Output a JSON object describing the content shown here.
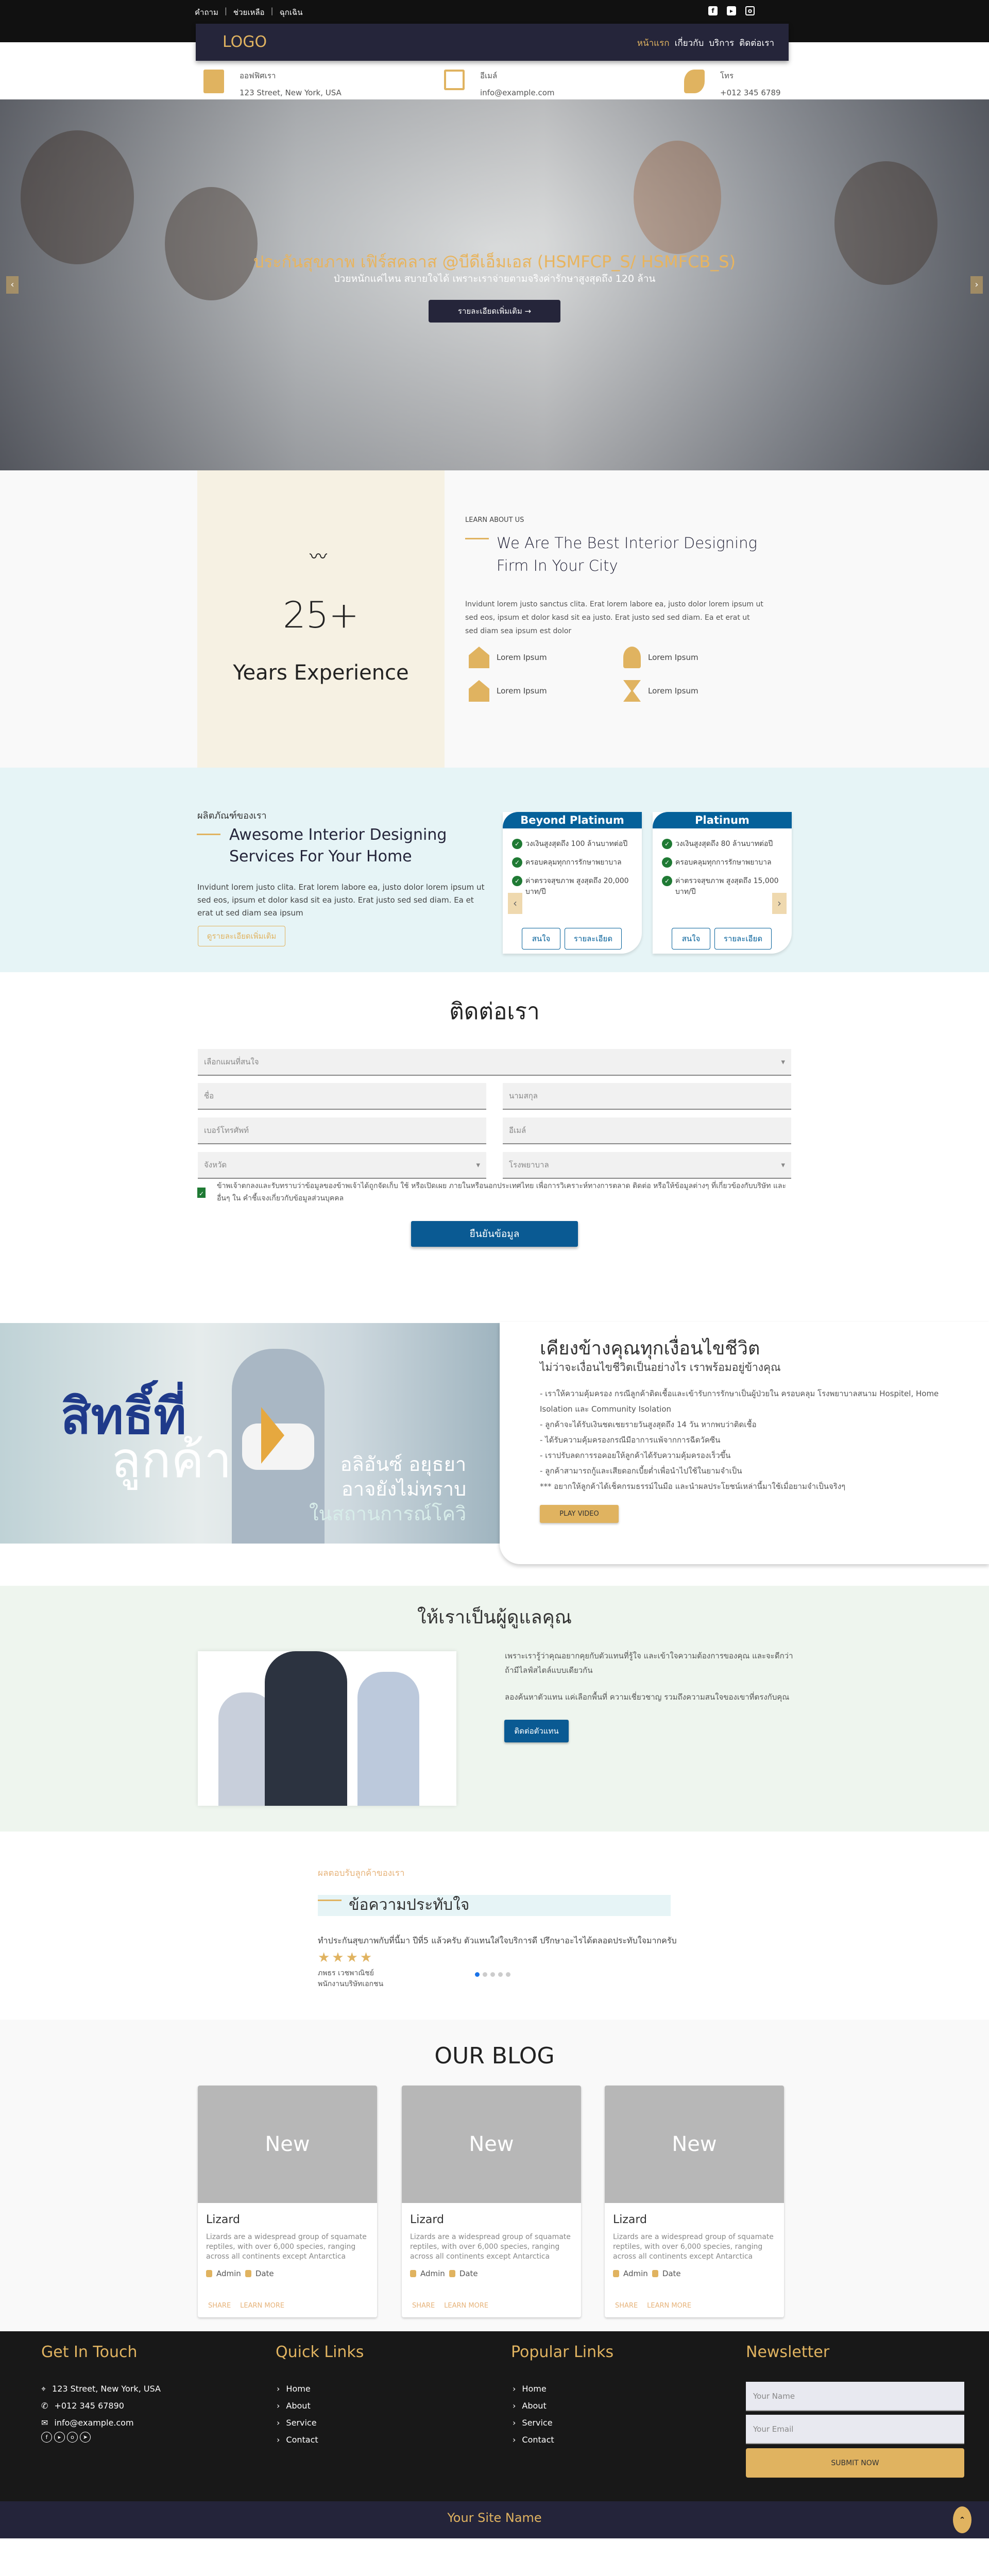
{
  "topbar": {
    "links": [
      "คำถาม",
      "ช่วยเหลือ",
      "ฉุกเฉิน"
    ],
    "social": [
      "facebook-icon",
      "youtube-icon",
      "instagram-icon"
    ]
  },
  "nav": {
    "logo": "LOGO",
    "menu": [
      "หน้าแรก",
      "เกี่ยวกับ",
      "บริการ",
      "ติดต่อเรา"
    ],
    "active": 0
  },
  "info": [
    {
      "icon": "building-icon",
      "label": "ออฟฟิศเรา",
      "value": "123 Street, New York, USA"
    },
    {
      "icon": "envelope-icon",
      "label": "อีเมล์",
      "value": "info@example.com"
    },
    {
      "icon": "phone-icon",
      "label": "โทร",
      "value": "+012 345 6789"
    }
  ],
  "hero": {
    "title": "ประกันสุขภาพ เฟิร์สคลาส @บีดีเอ็มเอส (HSMFCP_S/ HSMFCB_S)",
    "subtitle": "ป่วยหนักแค่ไหน สบายใจได้ เพราะเราจ่ายตามจริงค่ารักษาสูงสุดถึง 120 ล้าน",
    "button": "รายละเอียดเพิ่มเติม →",
    "prev": "‹",
    "next": "›"
  },
  "about": {
    "exp_number": "25+",
    "exp_label": "Years Experience",
    "kicker": "LEARN ABOUT US",
    "title": "We Are The Best Interior Designing Firm In Your City",
    "text": "Invidunt lorem justo sanctus clita. Erat lorem labore ea, justo dolor lorem ipsum ut sed eos, ipsum et dolor kasd sit ea justo. Erat justo sed sed diam. Ea et erat ut sed diam sea ipsum est dolor",
    "features": [
      "Lorem Ipsum",
      "Lorem Ipsum",
      "Lorem Ipsum",
      "Lorem Ipsum"
    ]
  },
  "products": {
    "kicker": "ผลิตภัณฑ์ของเรา",
    "title": "Awesome Interior Designing Services For Your Home",
    "text": "Invidunt lorem justo clita. Erat lorem labore ea, justo dolor lorem ipsum ut sed eos, ipsum et dolor kasd sit ea justo. Erat justo sed sed diam. Ea et erat ut sed diam sea ipsum",
    "button": "ดูรายละเอียดเพิ่มเติม",
    "plans": [
      {
        "name": "Beyond Platinum",
        "features": [
          "วงเงินสูงสุดถึง 100 ล้านบาทต่อปี",
          "ครอบคลุมทุกการรักษาพยาบาล",
          "ค่าตรวจสุขภาพ สูงสุดถึง 20,000 บาท/ปี"
        ],
        "interest": "สนใจ",
        "details": "รายละเอียด"
      },
      {
        "name": "Platinum",
        "features": [
          "วงเงินสูงสุดถึง 80 ล้านบาทต่อปี",
          "ครอบคลุมทุกการรักษาพยาบาล",
          "ค่าตรวจสุขภาพ สูงสุดถึง 15,000 บาท/ปี"
        ],
        "interest": "สนใจ",
        "details": "รายละเอียด"
      }
    ],
    "prev": "‹",
    "next": "›"
  },
  "contact": {
    "title": "ติดต่อเรา",
    "plan_placeholder": "เลือกแผนที่สนใจ",
    "first_name": "ชื่อ",
    "last_name": "นามสกุล",
    "phone": "เบอร์โทรศัพท์",
    "email": "อีเมล์",
    "province": "จังหวัด",
    "hospital": "โรงพยาบาล",
    "consent": "ข้าพเจ้าตกลงและรับทราบว่าข้อมูลของข้าพเจ้าได้ถูกจัดเก็บ ใช้ หรือเปิดเผย ภายในหรือนอกประเทศไทย เพื่อการวิเคราะห์ทางการตลาด ติดต่อ หรือให้ข้อมูลต่างๆ ที่เกี่ยวข้องกับบริษัท และอื่นๆ ใน คำชี้แจงเกี่ยวกับข้อมูลส่วนบุคคล",
    "consent_checked": true,
    "submit": "ยืนยันข้อมูล"
  },
  "video": {
    "overlay_1": "สิทธิ์ที่",
    "overlay_2": "ลูกค้า",
    "overlay_3": "อลิอันซ์ อยุธยา",
    "overlay_4": "อาจยังไม่ทราบ",
    "overlay_5": "ในสถานการณ์โควิ",
    "title": "เคียงข้างคุณทุกเงื่อนไขชีวิต",
    "subtitle": "ไม่ว่าจะเงื่อนไขชีวิตเป็นอย่างไร เราพร้อมอยู่ข้างคุณ",
    "points": [
      "- เราให้ความคุ้มครอง กรณีลูกค้าติดเชื้อและเข้ารับการรักษาเป็นผู้ป่วยใน ครอบคลุม โรงพยาบาลสนาม Hospitel, Home Isolation และ Community Isolation",
      "- ลูกค้าจะได้รับเงินชดเชยรายวันสูงสุดถึง 14 วัน หากพบว่าติดเชื้อ",
      "- ได้รับความคุ้มครองกรณีมีอาการแพ้จากการฉีดวัคซีน",
      "- เราปรับลดการรอคอยให้ลูกค้าได้รับความคุ้มครองเร็วขึ้น",
      "- ลูกค้าสามารถกู้และเสียดอกเบี้ยต่ำเพื่อนำไปใช้ในยามจำเป็น",
      "*** อยากให้ลูกค้าได้เช็คกรมธรรม์ในมือ และนำผลประโยชน์เหล่านี้มาใช้เมื่อยามจำเป็นจริงๆ"
    ],
    "button": "PLAY VIDEO"
  },
  "care": {
    "title": "ให้เราเป็นผู้ดูแลคุณ",
    "p1": "เพราะเรารู้ว่าคุณอยากคุยกับตัวแทนที่รู้ใจ และเข้าใจความต้องการของคุณ และจะดีกว่าถ้ามีไลฟ์สไตล์แบบเดียวกัน",
    "p2": "ลองค้นหาตัวแทน แค่เลือกพื้นที่ ความเชี่ยวชาญ รวมถึงความสนใจของเขาที่ตรงกับคุณ",
    "button": "ติดต่อตัวแทน"
  },
  "testimonial": {
    "kicker": "ผลตอบรับลูกค้าของเรา",
    "title": "ข้อความประทับใจ",
    "quote": "ทำประกันสุขภาพกับที่นี้มา ปีที่5 แล้วครับ ตัวแทนใส่ใจบริการดี ปรึกษาอะไรได้ตลอดประทับใจมากครับ",
    "rating": 4,
    "stars": "★★★★",
    "name": "ภพธร เวชพาณิชย์",
    "role": "พนักงานบริษัทเอกชน",
    "pages": 5,
    "current": 1
  },
  "blog": {
    "title": "OUR BLOG",
    "posts": [
      {
        "badge": "New",
        "title": "Lizard",
        "text": "Lizards are a widespread group of squamate reptiles, with over 6,000 species, ranging across all continents except Antarctica",
        "author": "Admin",
        "date": "Date",
        "share": "SHARE",
        "more": "LEARN MORE"
      },
      {
        "badge": "New",
        "title": "Lizard",
        "text": "Lizards are a widespread group of squamate reptiles, with over 6,000 species, ranging across all continents except Antarctica",
        "author": "Admin",
        "date": "Date",
        "share": "SHARE",
        "more": "LEARN MORE"
      },
      {
        "badge": "New",
        "title": "Lizard",
        "text": "Lizards are a widespread group of squamate reptiles, with over 6,000 species, ranging across all continents except Antarctica",
        "author": "Admin",
        "date": "Date",
        "share": "SHARE",
        "more": "LEARN MORE"
      }
    ]
  },
  "footer": {
    "touch_title": "Get In Touch",
    "address": "123 Street, New York, USA",
    "phone": "+012 345 67890",
    "email": "info@example.com",
    "quick_title": "Quick Links",
    "quick": [
      "Home",
      "About",
      "Service",
      "Contact"
    ],
    "popular_title": "Popular Links",
    "popular": [
      "Home",
      "About",
      "Service",
      "Contact"
    ],
    "news_title": "Newsletter",
    "name_ph": "Your Name",
    "email_ph": "Your Email",
    "submit": "SUBMIT NOW",
    "site_name": "Your Site Name",
    "to_top": "⌃"
  },
  "colors": {
    "accent": "#e0b360",
    "navy": "#25253a",
    "blue": "#0a5a93",
    "dark": "#181818"
  }
}
